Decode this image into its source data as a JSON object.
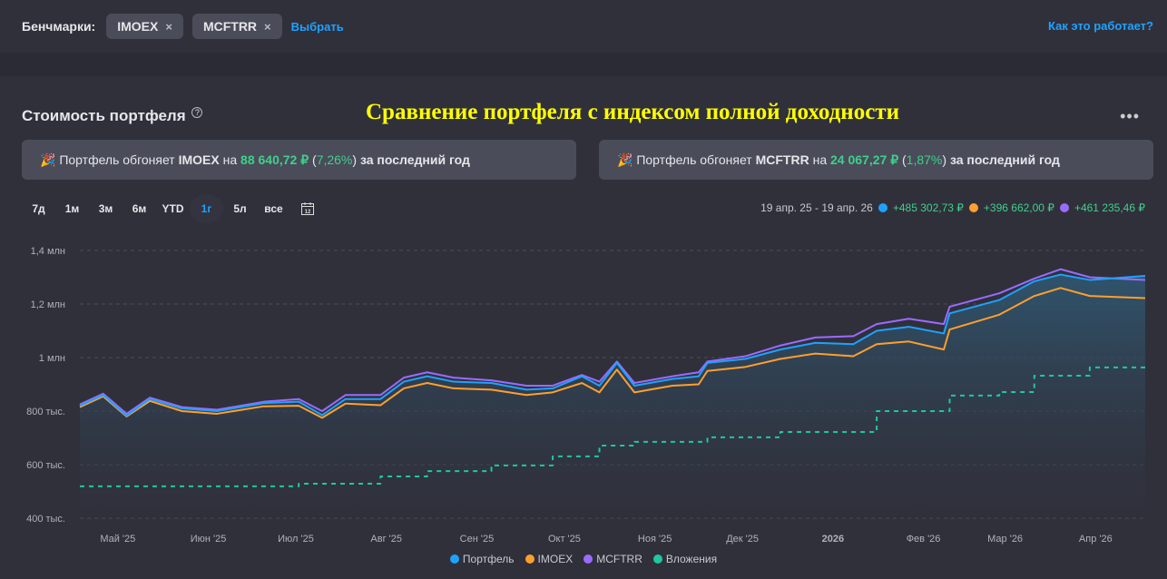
{
  "header": {
    "benchmarks_label": "Бенчмарки:",
    "chips": [
      {
        "label": "IMOEX",
        "close": "×"
      },
      {
        "label": "MCFTRR",
        "close": "×"
      }
    ],
    "select_link": "Выбрать",
    "how_link": "Как это работает?"
  },
  "card": {
    "title": "Стоимость портфеля",
    "help": "?",
    "overlay": "Сравнение портфеля с индексом полной доходности",
    "menu": "•••"
  },
  "banners": [
    {
      "emoji": "🎉",
      "pre": "Портфель обгоняет",
      "bench": "IMOEX",
      "on": "на",
      "amount": "88 640,72 ₽",
      "open": "(",
      "pct": "7,26%",
      "close": ")",
      "post": "за последний год"
    },
    {
      "emoji": "🎉",
      "pre": "Портфель обгоняет",
      "bench": "MCFTRR",
      "on": "на",
      "amount": "24 067,27 ₽",
      "open": "(",
      "pct": "1,87%",
      "close": ")",
      "post": "за последний год"
    }
  ],
  "periods": [
    "7д",
    "1м",
    "3м",
    "6м",
    "YTD",
    "1г",
    "5л",
    "все"
  ],
  "active_period": "1г",
  "range": {
    "dates": "19 апр. 25 - 19 апр. 26",
    "values": [
      "+485 302,73 ₽",
      "+396 662,00 ₽",
      "+461 235,46 ₽"
    ]
  },
  "chart_data": {
    "type": "line",
    "ylim": [
      400,
      1400
    ],
    "yticks": [
      {
        "v": 1400,
        "label": "1,4 млн"
      },
      {
        "v": 1200,
        "label": "1,2 млн"
      },
      {
        "v": 1000,
        "label": "1 млн"
      },
      {
        "v": 800,
        "label": "800 тыс."
      },
      {
        "v": 600,
        "label": "600 тыс."
      },
      {
        "v": 400,
        "label": "400 тыс."
      }
    ],
    "xlim": [
      0,
      365
    ],
    "xticks": [
      {
        "d": 13,
        "label": "Май '25"
      },
      {
        "d": 44,
        "label": "Июн '25"
      },
      {
        "d": 74,
        "label": "Июл '25"
      },
      {
        "d": 105,
        "label": "Авг '25"
      },
      {
        "d": 136,
        "label": "Сен '25"
      },
      {
        "d": 166,
        "label": "Окт '25"
      },
      {
        "d": 197,
        "label": "Ноя '25"
      },
      {
        "d": 227,
        "label": "Дек '25"
      },
      {
        "d": 258,
        "label": "2026"
      },
      {
        "d": 289,
        "label": "Фев '26"
      },
      {
        "d": 317,
        "label": "Мар '26"
      },
      {
        "d": 348,
        "label": "Апр '26"
      }
    ],
    "x": [
      0,
      8,
      16,
      24,
      35,
      47,
      63,
      75,
      83,
      91,
      103,
      111,
      119,
      128,
      141,
      153,
      162,
      172,
      178,
      184,
      190,
      203,
      212,
      215,
      228,
      240,
      252,
      265,
      273,
      284,
      296,
      298,
      315,
      327,
      336,
      346,
      365
    ],
    "series": [
      {
        "name": "Портфель",
        "color": "#1ea2ff",
        "values": [
          820,
          860,
          783,
          845,
          810,
          800,
          830,
          835,
          785,
          845,
          845,
          910,
          930,
          910,
          905,
          880,
          885,
          930,
          895,
          980,
          895,
          920,
          930,
          980,
          995,
          1030,
          1055,
          1050,
          1100,
          1115,
          1090,
          1165,
          1215,
          1285,
          1310,
          1290,
          1305
        ]
      },
      {
        "name": "IMOEX",
        "color": "#ff9f2e",
        "values": [
          815,
          855,
          780,
          838,
          800,
          790,
          818,
          820,
          775,
          828,
          822,
          885,
          905,
          885,
          880,
          860,
          870,
          905,
          870,
          955,
          870,
          895,
          900,
          950,
          965,
          995,
          1015,
          1005,
          1050,
          1060,
          1030,
          1105,
          1160,
          1230,
          1260,
          1230,
          1222
        ]
      },
      {
        "name": "MCFTRR",
        "color": "#9b6bff",
        "values": [
          825,
          865,
          790,
          850,
          815,
          805,
          835,
          845,
          800,
          860,
          860,
          925,
          945,
          925,
          915,
          895,
          895,
          935,
          910,
          985,
          905,
          930,
          945,
          985,
          1005,
          1045,
          1075,
          1080,
          1125,
          1145,
          1125,
          1190,
          1240,
          1295,
          1330,
          1300,
          1290
        ]
      },
      {
        "name": "Вложения",
        "color": "#1ec8a0",
        "dashed": true,
        "step": true,
        "values": [
          519,
          519,
          519,
          519,
          519,
          519,
          519,
          529,
          529,
          529,
          556,
          556,
          576,
          576,
          597,
          597,
          631,
          631,
          671,
          671,
          685,
          685,
          685,
          702,
          702,
          722,
          722,
          722,
          800,
          800,
          800,
          858,
          871,
          932,
          932,
          963,
          963
        ]
      }
    ]
  },
  "legend": [
    "Портфель",
    "IMOEX",
    "MCFTRR",
    "Вложения"
  ]
}
